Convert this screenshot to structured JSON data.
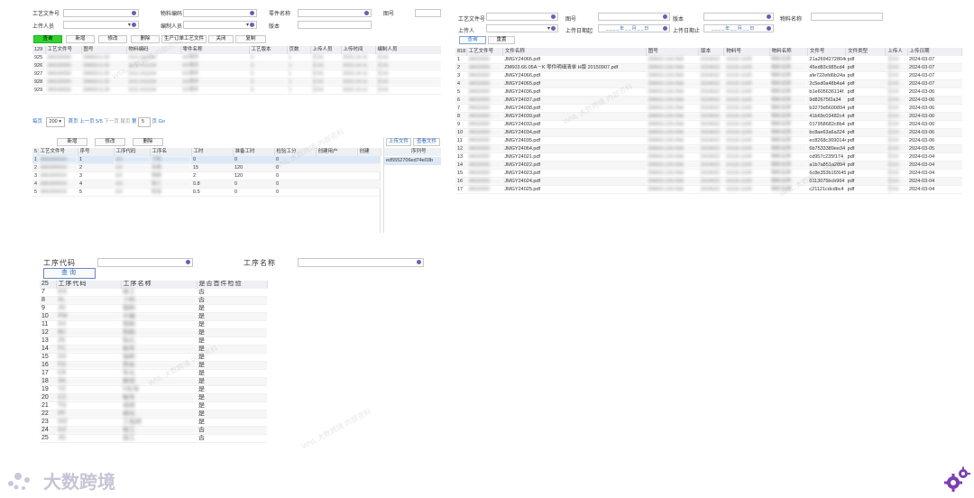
{
  "colors": {
    "accent": "#2ed42e",
    "icon": "#6a5fb3",
    "link": "#2b6cc4",
    "brand": "#7b3fb0"
  },
  "panel1": {
    "filters": [
      {
        "label": "工艺文件号"
      },
      {
        "label": "物料编码"
      },
      {
        "label": "零件名称"
      },
      {
        "label": "图号"
      },
      {
        "label": "上传人员"
      },
      {
        "label": "编制人员"
      },
      {
        "label": "版本"
      }
    ],
    "buttons": [
      "查询",
      "新增",
      "修改",
      "删除",
      "生产订单工艺文件",
      "关闭",
      "复制"
    ],
    "columns": [
      "工艺文件号",
      "图号",
      "物料编码",
      "零件名称",
      "工艺版本",
      "页数",
      "上传人员",
      "上传时间",
      "编制人员"
    ],
    "row_count": "129",
    "rows": [
      {
        "no": "925",
        "c": [
          "JMG00000",
          "ZM603.6.20",
          "1011-011104",
          "XX零件",
          "0",
          "1",
          "王XX",
          "2023-10-11",
          "王XX"
        ]
      },
      {
        "no": "926",
        "c": [
          "JMG00000",
          "ZM603.6.20",
          "1011-011104",
          "XX零件",
          "0",
          "1",
          "王XX",
          "2023-10-11",
          "王XX"
        ]
      },
      {
        "no": "927",
        "c": [
          "JMG00000",
          "ZM603.6.20",
          "1011-011104",
          "XX零件",
          "0",
          "1",
          "王XX",
          "2023-10-11",
          "王XX"
        ]
      },
      {
        "no": "928",
        "c": [
          "JMG00000",
          "ZM603.6.20",
          "1011-011104",
          "XX零件",
          "0",
          "1",
          "王XX",
          "2023-10-11",
          "王XX"
        ]
      },
      {
        "no": "929",
        "c": [
          "JMG00000",
          "ZM603.6.20",
          "1011-011104",
          "XX零件",
          "0",
          "1",
          "王XX",
          "2023-10-11",
          "王XX"
        ]
      }
    ],
    "pager": {
      "per_page_label": "每页",
      "per_page": "200",
      "first": "首页",
      "prev": "上一页",
      "pages": "5/5",
      "next": "下一页",
      "last": "尾页",
      "goto_label": "第",
      "page": "5",
      "page_unit": "页",
      "go": "Go"
    },
    "sub_buttons": [
      "新增",
      "修改",
      "删除"
    ],
    "sub_columns": [
      "工艺文件号",
      "序号",
      "工序代码",
      "工序名",
      "工时",
      "准备工时",
      "检验工分",
      "创建用户",
      "创建"
    ],
    "sub_rows": [
      {
        "no": "1",
        "c": [
          "JMG000024",
          "1",
          "GX",
          "下料",
          "0",
          "0",
          "0"
        ]
      },
      {
        "no": "2",
        "c": [
          "JMG000024",
          "2",
          "GX",
          "车削",
          "15",
          "120",
          "0"
        ]
      },
      {
        "no": "3",
        "c": [
          "JMG000024",
          "3",
          "GX",
          "铣削",
          "2",
          "120",
          "0"
        ]
      },
      {
        "no": "4",
        "c": [
          "JMG000024",
          "4",
          "GX",
          "钳工",
          "0.8",
          "0",
          "0"
        ]
      },
      {
        "no": "5",
        "c": [
          "JMG000024",
          "5",
          "GX",
          "检验",
          "0.5",
          "0",
          "0"
        ]
      }
    ],
    "upload": {
      "button": "上传文件",
      "button2": "查看文件",
      "col_seq": "序列号",
      "value": "ed5552706ed74e03b"
    }
  },
  "panel2": {
    "filters": [
      {
        "label": "工艺文件号"
      },
      {
        "label": "图号"
      },
      {
        "label": "版本"
      },
      {
        "label": "物料名称"
      },
      {
        "label": "上传人"
      },
      {
        "label": "上传日期起"
      },
      {
        "label": "上传日期止"
      }
    ],
    "date_placeholder": "____年__月__日",
    "buttons": [
      "查询",
      "重置"
    ],
    "row_count": "818",
    "columns": [
      "工艺文件号",
      "文件名称",
      "图号",
      "版本",
      "物料号",
      "物料名称",
      "文件号",
      "文件类型",
      "上传人",
      "上传日期"
    ],
    "rows": [
      {
        "no": "1",
        "file": "JMGY24066.pdf",
        "hash": "21a2694272804c",
        "type": "pdf",
        "date": "2024-03-07"
      },
      {
        "no": "2",
        "file": "ZM603.66.05A－K 零件明细清单 H版 20150907.pdf",
        "hash": "45ed83c985cd4",
        "type": "pdf",
        "date": "2024-03-07"
      },
      {
        "no": "3",
        "file": "JMGY24066.pdf",
        "hash": "afe722efd6b24a",
        "type": "pdf",
        "date": "2024-03-07"
      },
      {
        "no": "4",
        "file": "JMGY24065.pdf",
        "hash": "2c5ed0a48b4a4",
        "type": "pdf",
        "date": "2024-03-07"
      },
      {
        "no": "5",
        "file": "JMGY24036.pdf",
        "hash": "b1e605636114f",
        "type": "pdf",
        "date": "2024-03-06"
      },
      {
        "no": "6",
        "file": "JMGY24037.pdf",
        "hash": "9d82675f2a34",
        "type": "pdf",
        "date": "2024-03-06"
      },
      {
        "no": "7",
        "file": "JMGY24038.pdf",
        "hash": "b3279d5600894",
        "type": "pdf",
        "date": "2024-03-06"
      },
      {
        "no": "8",
        "file": "JMGY24039.pdf",
        "hash": "41b69c03482c4",
        "type": "pdf",
        "date": "2024-03-06"
      },
      {
        "no": "9",
        "file": "JMGY24033.pdf",
        "hash": "017958682c8b4",
        "type": "pdf",
        "date": "2024-03-06"
      },
      {
        "no": "10",
        "file": "JMGY24034.pdf",
        "hash": "bc8ae63a6a324",
        "type": "pdf",
        "date": "2024-03-06"
      },
      {
        "no": "11",
        "file": "JMGY24035.pdf",
        "hash": "ec8268c3690144",
        "type": "pdf",
        "date": "2024-03-06"
      },
      {
        "no": "12",
        "file": "JMGY24064.pdf",
        "hash": "6b7533389ee34",
        "type": "pdf",
        "date": "2024-03-05"
      },
      {
        "no": "13",
        "file": "JMGY24021.pdf",
        "hash": "cd957c235f174",
        "type": "pdf",
        "date": "2024-03-04"
      },
      {
        "no": "14",
        "file": "JMGY24022.pdf",
        "hash": "a1b7a851a2894",
        "type": "pdf",
        "date": "2024-03-04"
      },
      {
        "no": "15",
        "file": "JMGY24023.pdf",
        "hash": "6c8e353b1f2645",
        "type": "pdf",
        "date": "2024-03-04"
      },
      {
        "no": "16",
        "file": "JMGY24024.pdf",
        "hash": "0113075bcb964",
        "type": "pdf",
        "date": "2024-03-04"
      },
      {
        "no": "17",
        "file": "JMGY24025.pdf",
        "hash": "c21121cdcdbc4",
        "type": "pdf",
        "date": "2024-03-04"
      }
    ]
  },
  "panel3": {
    "filters": [
      {
        "label": "工序代码"
      },
      {
        "label": "工序名称"
      }
    ],
    "button": "查询",
    "row_count": "25",
    "columns": [
      "工序代码",
      "工序名称",
      "是否首件检验"
    ],
    "rows": [
      {
        "no": "7",
        "code": "GX",
        "name": "钳工",
        "check": "否"
      },
      {
        "no": "8",
        "code": "XL",
        "name": "下料",
        "check": "否"
      },
      {
        "no": "9",
        "code": "JG",
        "name": "镗削",
        "check": "是"
      },
      {
        "no": "10",
        "code": "PM",
        "name": "平磨",
        "check": "是"
      },
      {
        "no": "11",
        "code": "XX",
        "name": "铣削",
        "check": "是"
      },
      {
        "no": "12",
        "code": "BC",
        "name": "刨削",
        "check": "是"
      },
      {
        "no": "13",
        "code": "ZK",
        "name": "钻孔",
        "check": "是"
      },
      {
        "no": "14",
        "code": "FC",
        "name": "精车",
        "check": "是"
      },
      {
        "no": "15",
        "code": "DX",
        "name": "插削",
        "check": "是"
      },
      {
        "no": "16",
        "code": "FD",
        "name": "热处",
        "check": "是"
      },
      {
        "no": "17",
        "code": "CK",
        "name": "车孔",
        "check": "是"
      },
      {
        "no": "18",
        "code": "SK",
        "name": "数控",
        "check": "是"
      },
      {
        "no": "19",
        "code": "YC",
        "name": "V形车",
        "check": "是"
      },
      {
        "no": "20",
        "code": "CC",
        "name": "粗车",
        "check": "是"
      },
      {
        "no": "21",
        "code": "TG",
        "name": "调质",
        "check": "是"
      },
      {
        "no": "22",
        "code": "PF",
        "name": "磷化",
        "check": "是"
      },
      {
        "no": "23",
        "code": "GD",
        "name": "工程割",
        "check": "是"
      },
      {
        "no": "24",
        "code": "GZ",
        "name": "钳工",
        "check": "否"
      },
      {
        "no": "25",
        "code": "JG",
        "name": "加工",
        "check": "否"
      }
    ]
  },
  "brand": {
    "name": "大数跨境"
  }
}
